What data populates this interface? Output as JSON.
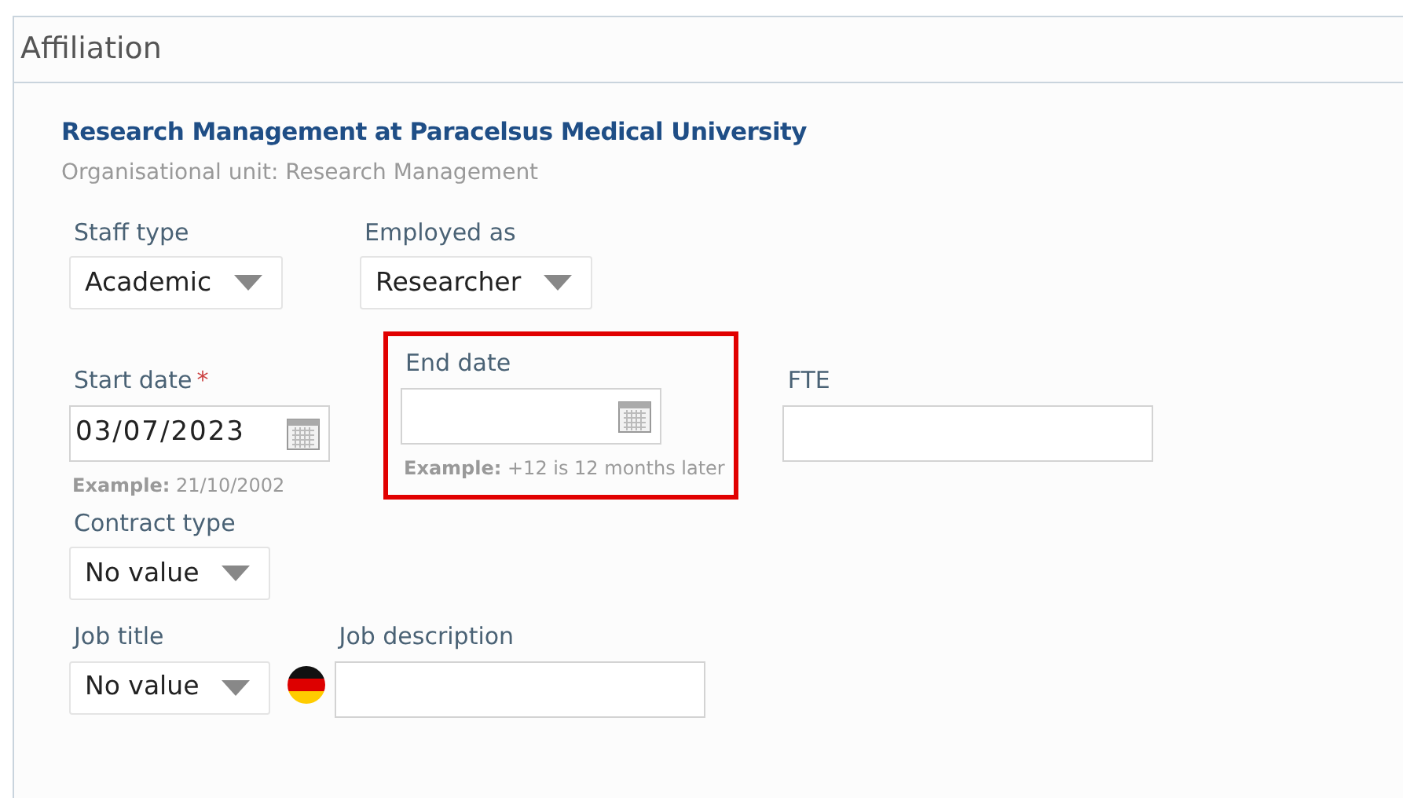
{
  "panel": {
    "title": "Affiliation"
  },
  "organisation": {
    "name": "Research Management at Paracelsus Medical University",
    "unit": "Organisational unit: Research Management"
  },
  "rows": [
    [
      {
        "kind": "select",
        "label": "Staff type",
        "value": "Academic"
      },
      {
        "kind": "select",
        "label": "Employed as",
        "value": "Researcher"
      }
    ],
    [
      {
        "kind": "date",
        "label": "Start date",
        "required_mark": "*",
        "value": "03/07/2023",
        "hint": "**Example:** 21/10/2002",
        "highlighted": false
      },
      {
        "kind": "date",
        "label": "End date",
        "hint": "**Example:** +12 is 12 months later",
        "highlighted": true
      },
      {
        "kind": "text",
        "label": "FTE",
        "highlighted": false
      }
    ],
    [
      {
        "kind": "select",
        "label": "Contract type",
        "value": "No value"
      }
    ],
    [
      {
        "kind": "select",
        "label": "Job title",
        "value": "No value"
      },
      {
        "kind": "translatable_text",
        "label": "Job description",
        "highlighted": false
      }
    ]
  ]
}
